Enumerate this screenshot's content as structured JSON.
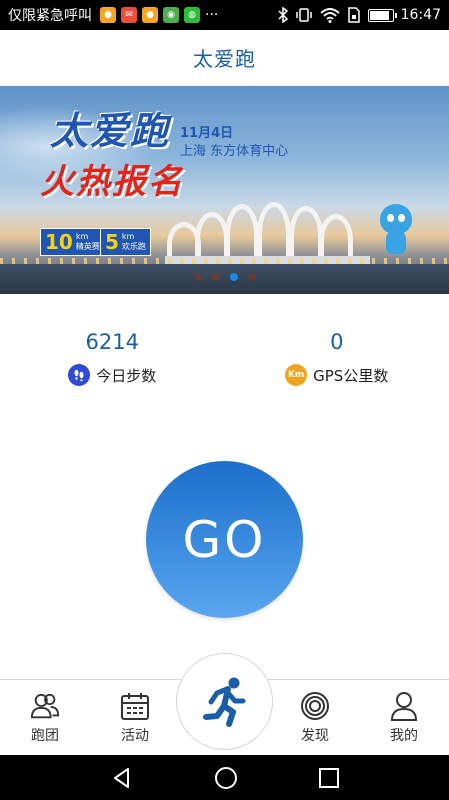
{
  "status_bar": {
    "carrier": "仅限紧急呼叫",
    "notifications": [
      {
        "icon": "app-notification-icon",
        "color": "#f5a623"
      },
      {
        "icon": "mail-notification-icon",
        "color": "#e94e3c"
      },
      {
        "icon": "app-notification-icon",
        "color": "#f5a623"
      },
      {
        "icon": "map-notification-icon",
        "color": "#4caf50"
      },
      {
        "icon": "wechat-notification-icon",
        "color": "#2dbd38"
      }
    ],
    "more": "···",
    "time": "16:47",
    "battery_level": 0.9
  },
  "header": {
    "title": "太爱跑"
  },
  "banner": {
    "title": "太爱跑",
    "subtitle": "火热报名",
    "date": "11月4日",
    "venue": "上海  东方体育中心",
    "badges": [
      {
        "num": "10",
        "unit": "km",
        "name": "精英赛"
      },
      {
        "num": "5",
        "unit": "km",
        "name": "欢乐跑"
      }
    ],
    "page_count": 4,
    "active_page": 3
  },
  "stats": {
    "steps": {
      "value": "6214",
      "label": "今日步数",
      "icon": "footsteps-icon"
    },
    "gps": {
      "value": "0",
      "label": "GPS公里数",
      "icon": "km-icon",
      "icon_text": "Km"
    }
  },
  "go_button": {
    "label": "GO"
  },
  "tabbar": {
    "tabs": [
      {
        "label": "跑团",
        "icon": "group-icon"
      },
      {
        "label": "活动",
        "icon": "calendar-icon"
      },
      {
        "label": "",
        "icon": "runner-icon"
      },
      {
        "label": "发现",
        "icon": "discover-target-icon"
      },
      {
        "label": "我的",
        "icon": "profile-icon"
      }
    ]
  },
  "colors": {
    "accent": "#1a5ea8",
    "go_top": "#1d6fcc",
    "go_bottom": "#5aa6ee",
    "steps_icon": "#2f49d8",
    "km_icon": "#f2a31f"
  }
}
